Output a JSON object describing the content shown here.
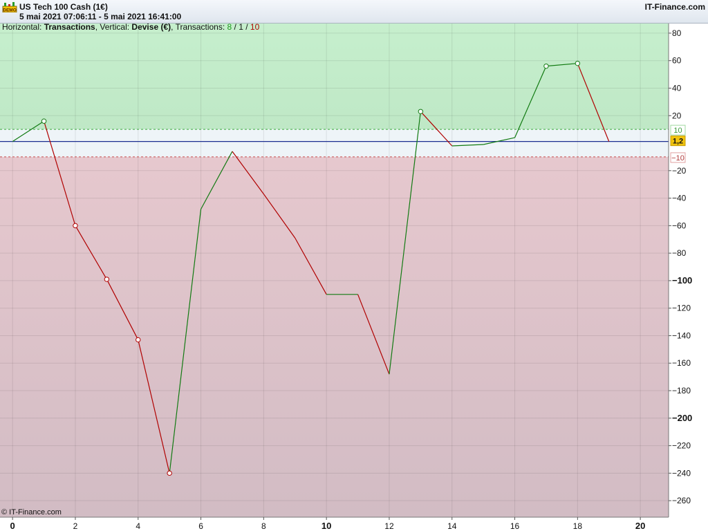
{
  "header": {
    "title": "US Tech 100 Cash (1€)",
    "dates": "5 mai 2021 07:06:11 - 5 mai 2021 16:41:00",
    "brand": "IT-Finance.com"
  },
  "info": {
    "h_label": "Horizontal: ",
    "h_value": "Transactions",
    "v_label": ", Vertical: ",
    "v_value": "Devise (€)",
    "t_label": ", Transactions: ",
    "wins": "8",
    "sep1": " / ",
    "neutral": "1",
    "sep2": " / ",
    "losses": "10"
  },
  "copyright": "© IT-Finance.com",
  "colors": {
    "up": "#117a11",
    "down": "#b00000",
    "profit_zone": "#c6efcd",
    "loss_zone": "#e6c8ce",
    "neutral_band": "#eef4f8",
    "zero_line": "#1a2d8f",
    "current_badge": "#f2c40f"
  },
  "chart_data": {
    "type": "line",
    "x": [
      0,
      1,
      2,
      3,
      4,
      5,
      6,
      7,
      8,
      9,
      10,
      11,
      12,
      13,
      14,
      15,
      16,
      17,
      18,
      19
    ],
    "y": [
      1.2,
      16,
      -60,
      -99,
      -143,
      -240,
      -48,
      -6,
      -37,
      -69,
      -110,
      -110,
      -168,
      23,
      -2,
      -1,
      4,
      56,
      58,
      1.2
    ],
    "markers": [
      1,
      2,
      3,
      4,
      5,
      13,
      17,
      18
    ],
    "xlim": [
      -0.4,
      20.9
    ],
    "ylim": [
      -272,
      87
    ],
    "x_ticks": [
      0,
      2,
      4,
      6,
      8,
      10,
      12,
      14,
      16,
      18,
      20
    ],
    "x_major_ticks": [
      0,
      10,
      20
    ],
    "y_ticks": [
      80,
      60,
      40,
      20,
      -20,
      -40,
      -60,
      -80,
      -100,
      -120,
      -140,
      -160,
      -180,
      -200,
      -220,
      -240,
      -260
    ],
    "y_major_ticks": [
      -100,
      -200
    ],
    "upper_threshold": 10,
    "lower_threshold": -10,
    "current_value": 1.2,
    "current_label": "1,2",
    "upper_label": "10",
    "lower_label": "-10",
    "grid": true
  }
}
